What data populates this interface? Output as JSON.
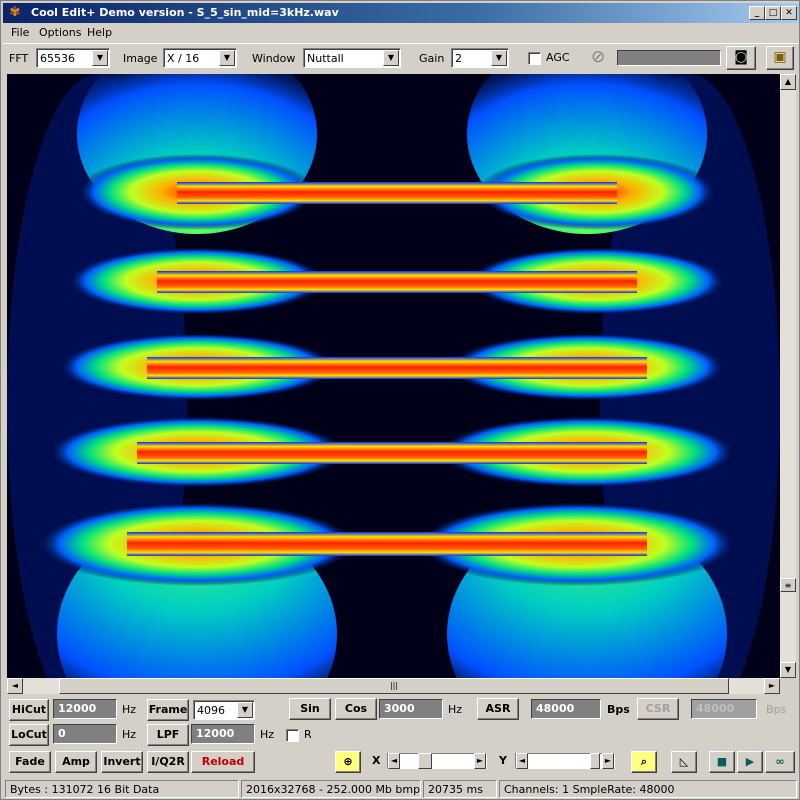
{
  "window": {
    "title": "Cool Edit+  Demo version - S_5_sin_mid=3kHz.wav"
  },
  "menu": [
    "File",
    "Options",
    "Help"
  ],
  "toolbar": {
    "fft_label": "FFT",
    "fft_value": "65536",
    "image_label": "Image",
    "image_value": "X / 16",
    "window_label": "Window",
    "window_value": "Nuttall",
    "gain_label": "Gain",
    "gain_value": "2",
    "agc_label": "AGC"
  },
  "controls": {
    "hicut_label": "HiCut",
    "hicut_value": "12000",
    "hicut_unit": "Hz",
    "locut_label": "LoCut",
    "locut_value": "0",
    "locut_unit": "Hz",
    "frame_label": "Frame",
    "frame_value": "4096",
    "lpf_label": "LPF",
    "lpf_value": "12000",
    "lpf_unit": "Hz",
    "r_label": "R",
    "sin_label": "Sin",
    "cos_label": "Cos",
    "freq_value": "3000",
    "freq_unit": "Hz",
    "asr_label": "ASR",
    "asr_value": "48000",
    "asr_unit": "Bps",
    "csr_label": "CSR",
    "csr_value": "48000",
    "csr_unit": "Bps",
    "fade_label": "Fade",
    "amp_label": "Amp",
    "invert_label": "Invert",
    "iq2r_label": "I/Q2R",
    "reload_label": "Reload",
    "x_label": "X",
    "y_label": "Y"
  },
  "status": {
    "bytes": "Bytes : 131072 16 Bit Data",
    "bmp": "2016x32768 - 252.000 Mb bmp",
    "ms": "20735 ms",
    "channels": "Channels: 1  SmpleRate: 48000"
  }
}
